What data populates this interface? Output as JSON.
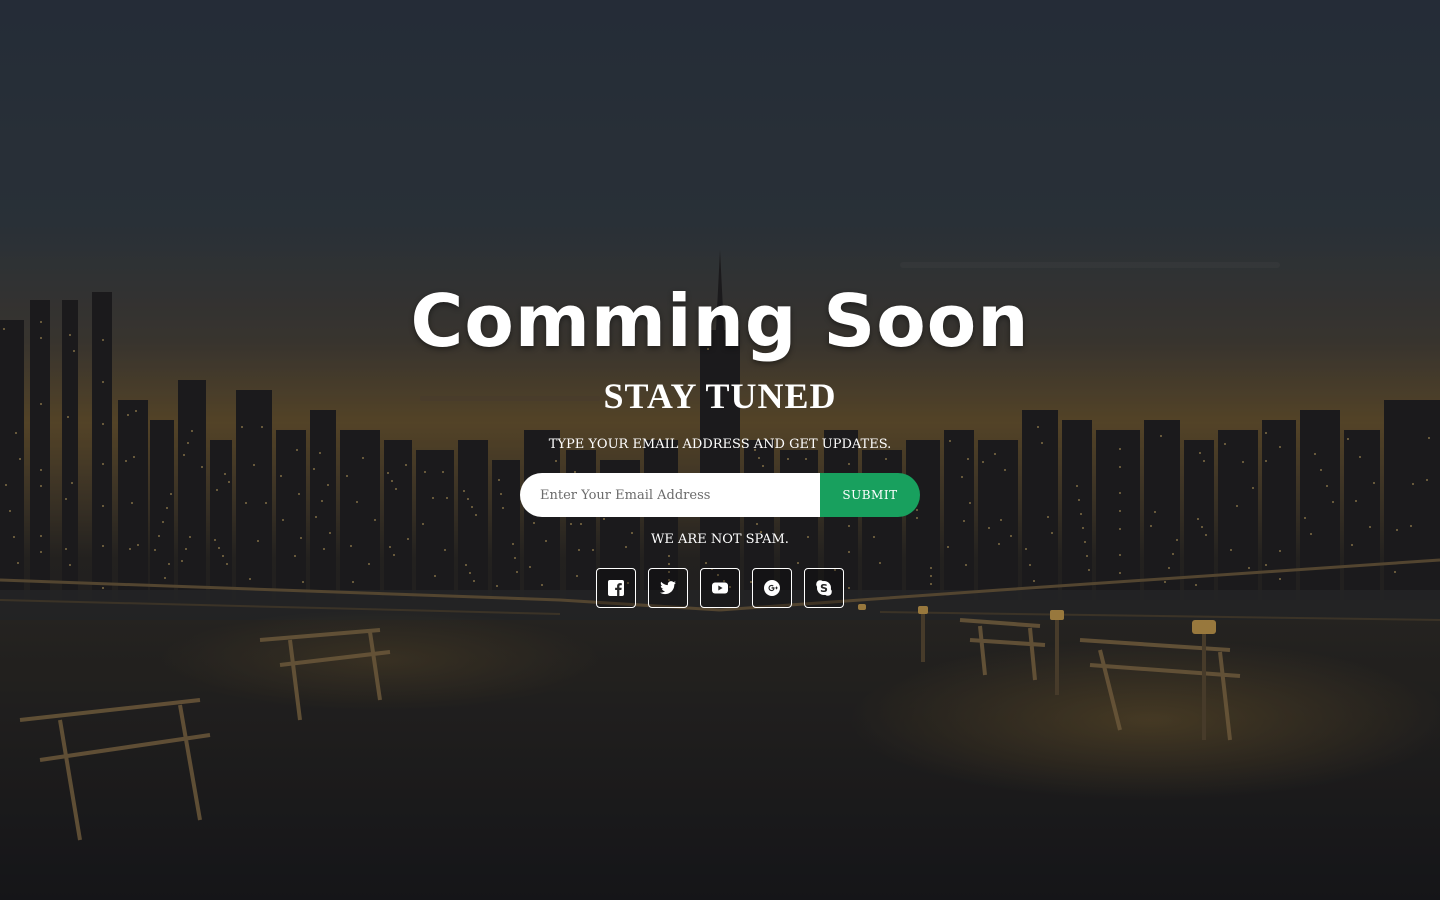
{
  "hero": {
    "title": "Comming Soon",
    "subtitle": "STAY TUNED",
    "tagline": "TYPE YOUR EMAIL ADDRESS AND GET UPDATES."
  },
  "signup": {
    "placeholder": "Enter Your Email Address",
    "submit_label": "SUBMIT"
  },
  "spam_note": "WE ARE NOT SPAM.",
  "social": [
    {
      "icon": "facebook-icon"
    },
    {
      "icon": "twitter-icon"
    },
    {
      "icon": "youtube-icon"
    },
    {
      "icon": "google-plus-icon"
    },
    {
      "icon": "skype-icon"
    }
  ],
  "colors": {
    "accent": "#18a05e",
    "text": "#ffffff",
    "overlay_top": "#2b3340",
    "horizon_glow": "#7a5a24"
  }
}
